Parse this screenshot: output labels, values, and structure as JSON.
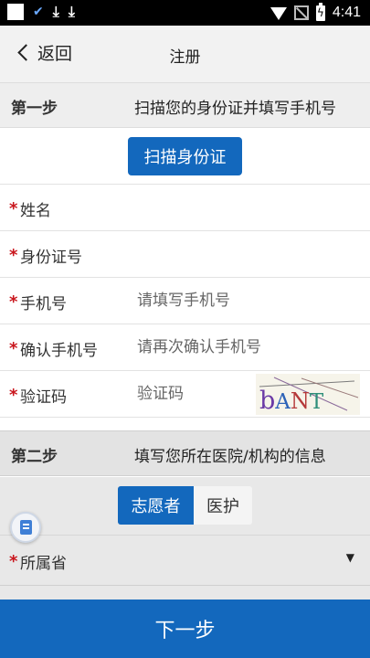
{
  "status_bar": {
    "time": "4:41",
    "icons": [
      "square-icon",
      "check-icon",
      "download-icon",
      "download-icon",
      "wifi-icon",
      "no-signal-icon",
      "battery-charging-icon"
    ]
  },
  "header": {
    "back_label": "返回",
    "title": "注册"
  },
  "step1": {
    "label": "第一步",
    "description": "扫描您的身份证并填写手机号",
    "scan_button": "扫描身份证"
  },
  "fields": {
    "name": {
      "required_mark": "*",
      "label": "姓名",
      "value": "",
      "placeholder": ""
    },
    "id_number": {
      "required_mark": "*",
      "label": "身份证号",
      "value": "",
      "placeholder": ""
    },
    "phone": {
      "required_mark": "*",
      "label": "手机号",
      "value": "",
      "placeholder": "请填写手机号"
    },
    "confirm_phone": {
      "required_mark": "*",
      "label": "确认手机号",
      "value": "",
      "placeholder": "请再次确认手机号"
    },
    "captcha": {
      "required_mark": "*",
      "label": "验证码",
      "value": "",
      "placeholder": "验证码",
      "image_text": "bANT"
    }
  },
  "step2": {
    "label": "第二步",
    "description": "填写您所在医院/机构的信息",
    "toggle": {
      "selected": "志愿者",
      "options": [
        "志愿者",
        "医护"
      ]
    },
    "province": {
      "required_mark": "*",
      "label": "所属省",
      "value": ""
    }
  },
  "footer": {
    "next_button": "下一步"
  },
  "colors": {
    "primary": "#1368bd",
    "required": "#c9161d",
    "status_bar": "#000000",
    "header_bg": "#f2f2f2"
  }
}
